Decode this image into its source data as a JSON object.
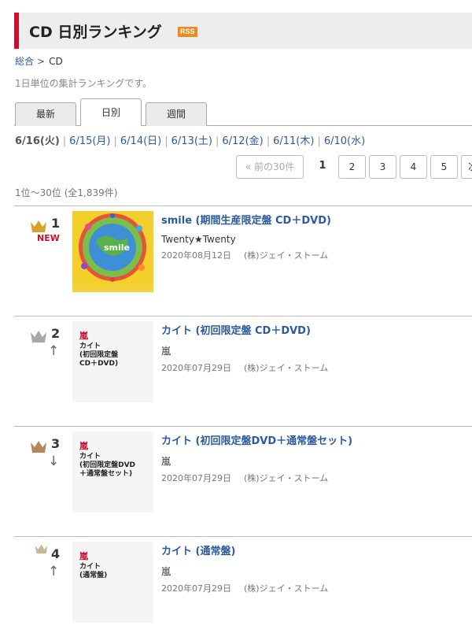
{
  "header": {
    "title": "CD 日別ランキング",
    "rss": "RSS"
  },
  "breadcrumb": {
    "home": "総合",
    "sep": ">",
    "current": "CD"
  },
  "description": "1日単位の集計ランキングです。",
  "tabs": [
    {
      "label": "最新",
      "active": false
    },
    {
      "label": "日別",
      "active": true
    },
    {
      "label": "週間",
      "active": false
    }
  ],
  "dates": [
    "6/16(火)",
    "6/15(月)",
    "6/14(日)",
    "6/13(土)",
    "6/12(金)",
    "6/11(木)",
    "6/10(水)"
  ],
  "pager": {
    "prev": "« 前の30件",
    "current": "1",
    "pages": [
      "2",
      "3",
      "4",
      "5",
      "次"
    ]
  },
  "count": "1位〜30位 (全1,839件)",
  "items": [
    {
      "rank": "1",
      "crown": "gold-crown",
      "badge": "NEW",
      "arrow": "",
      "title": "smile (期間生産限定盤 CD＋DVD)",
      "artist": "Twenty★Twenty",
      "date": "2020年08月12日",
      "label": "(株)ジェイ・ストーム",
      "jacket_artist": "",
      "jacket_title": "",
      "jacket_text": "smile"
    },
    {
      "rank": "2",
      "crown": "silver-crown",
      "badge": "",
      "arrow": "↑",
      "title": "カイト (初回限定盤 CD＋DVD)",
      "artist": "嵐",
      "date": "2020年07月29日",
      "label": "(株)ジェイ・ストーム",
      "jacket_artist": "嵐",
      "jacket_title": "カイト\n(初回限定盤\nCD＋DVD)"
    },
    {
      "rank": "3",
      "crown": "bronze-crown",
      "badge": "",
      "arrow": "↓",
      "title": "カイト (初回限定盤DVD＋通常盤セット)",
      "artist": "嵐",
      "date": "2020年07月29日",
      "label": "(株)ジェイ・ストーム",
      "jacket_artist": "嵐",
      "jacket_title": "カイト\n(初回限定盤DVD\n＋通常盤セット)"
    },
    {
      "rank": "4",
      "crown": "crown-icon",
      "badge": "",
      "arrow": "↑",
      "title": "カイト (通常盤)",
      "artist": "嵐",
      "date": "2020年07月29日",
      "label": "(株)ジェイ・ストーム",
      "jacket_artist": "嵐",
      "jacket_title": "カイト\n(通常盤)"
    }
  ],
  "colors": {
    "accent": "#c8102e",
    "link": "#2c5aa0",
    "gold": "#d9a02b",
    "silver": "#a8a8a8",
    "bronze": "#b8865b",
    "plain": "#c9b79a"
  }
}
